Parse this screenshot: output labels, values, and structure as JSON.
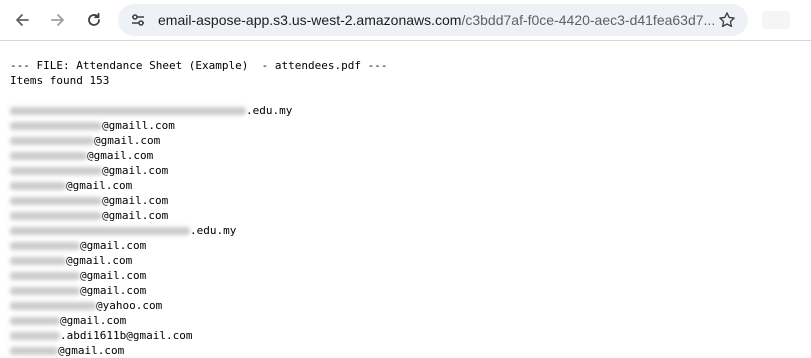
{
  "browser": {
    "url_host": "email-aspose-app.s3.us-west-2.amazonaws.com",
    "url_path": "/c3bdd7af-f0ce-4420-aec3-d41fea63d7..."
  },
  "content": {
    "file_header": "--- FILE: Attendance Sheet (Example)  - attendees.pdf ---",
    "items_found": "Items found 153",
    "entries": [
      ".edu.my",
      "@gmaill.com",
      "@gmail.com",
      "@gmail.com",
      "@gmail.com",
      "@gmail.com",
      "@gmail.com",
      "@gmail.com",
      ".edu.my",
      "@gmail.com",
      "@gmail.com",
      "@gmail.com",
      "@gmail.com",
      "@yahoo.com",
      "@gmail.com",
      ".abdi1611b@gmail.com",
      "@gmail.com"
    ]
  }
}
